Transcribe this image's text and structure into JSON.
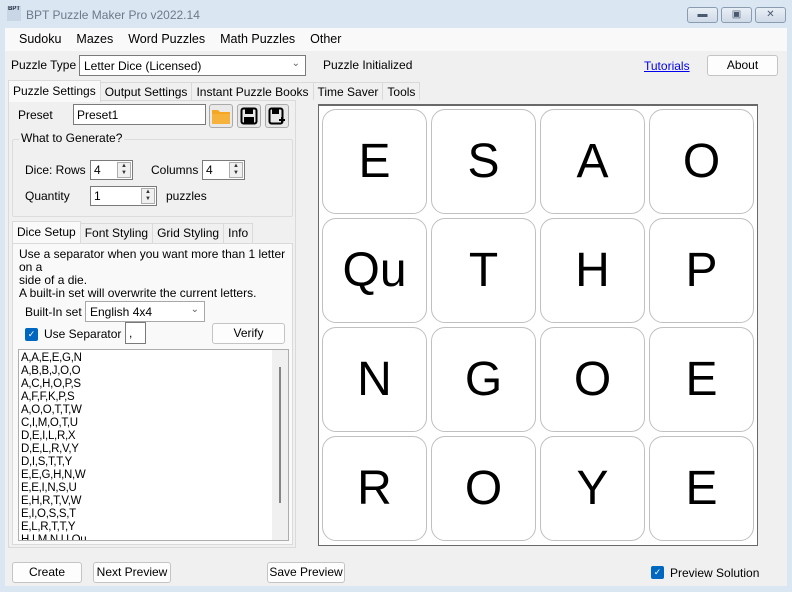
{
  "window": {
    "title": "BPT Puzzle Maker Pro v2022.14",
    "icon_text": "BPT",
    "controls": [
      "minimize-icon",
      "maximize-icon",
      "close-icon"
    ]
  },
  "menu": [
    "Sudoku",
    "Mazes",
    "Word Puzzles",
    "Math Puzzles",
    "Other"
  ],
  "toolbar": {
    "puzzle_type_label": "Puzzle Type",
    "puzzle_type_value": "Letter Dice (Licensed)",
    "status": "Puzzle Initialized",
    "tutorials_link": "Tutorials",
    "about_button": "About"
  },
  "main_tabs": [
    "Puzzle Settings",
    "Output Settings",
    "Instant Puzzle Books",
    "Time Saver",
    "Tools"
  ],
  "settings": {
    "preset_label": "Preset",
    "preset_value": "Preset1",
    "icons": [
      "open-folder-icon",
      "save-icon",
      "save-as-icon"
    ],
    "generate_group_title": "What to Generate?",
    "rows_label": "Dice: Rows",
    "rows_value": "4",
    "columns_label": "Columns",
    "columns_value": "4",
    "quantity_label": "Quantity",
    "quantity_value": "1",
    "quantity_unit": "puzzles"
  },
  "sub_tabs": [
    "Dice Setup",
    "Font Styling",
    "Grid Styling",
    "Info"
  ],
  "dice_setup": {
    "help_line1": "Use a separator when you want more than 1 letter on a",
    "help_line2": "side of a die.",
    "help_line3": "A built-in set will overwrite the current letters.",
    "builtin_label": "Built-In set",
    "builtin_value": "English 4x4",
    "use_separator_label": "Use Separator",
    "use_separator_checked": true,
    "separator_value": ",",
    "verify_button": "Verify",
    "dice_lines": [
      "A,A,E,E,G,N",
      "A,B,B,J,O,O",
      "A,C,H,O,P,S",
      "A,F,F,K,P,S",
      "A,O,O,T,T,W",
      "C,I,M,O,T,U",
      "D,E,I,L,R,X",
      "D,E,L,R,V,Y",
      "D,I,S,T,T,Y",
      "E,E,G,H,N,W",
      "E,E,I,N,S,U",
      "E,H,R,T,V,W",
      "E,I,O,S,S,T",
      "E,L,R,T,T,Y",
      "H,I,M,N,U,Qu"
    ]
  },
  "preview": {
    "grid": [
      [
        "E",
        "S",
        "A",
        "O"
      ],
      [
        "Qu",
        "T",
        "H",
        "P"
      ],
      [
        "N",
        "G",
        "O",
        "E"
      ],
      [
        "R",
        "O",
        "Y",
        "E"
      ]
    ]
  },
  "bottom": {
    "create_button": "Create",
    "next_preview_button": "Next Preview",
    "save_preview_button": "Save Preview",
    "preview_solution_label": "Preview Solution",
    "preview_solution_checked": true
  },
  "colors": {
    "accent": "#0067c0",
    "link": "#0000ee",
    "folder": "#f5a623"
  }
}
